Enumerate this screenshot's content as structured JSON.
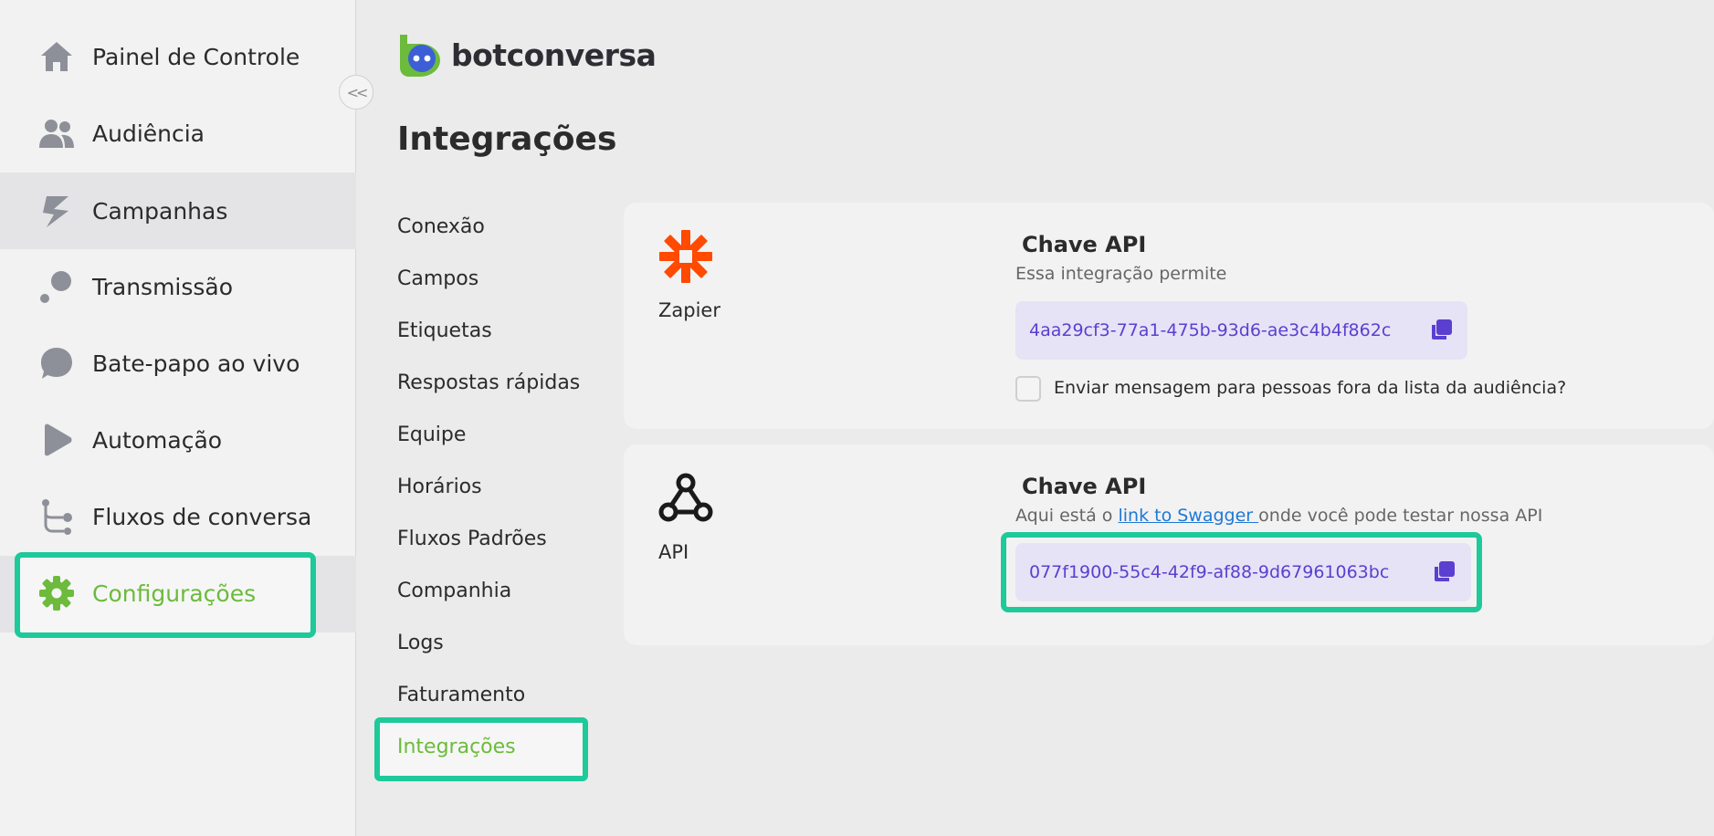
{
  "brand": {
    "name": "botconversa"
  },
  "sidebar": {
    "items": [
      {
        "label": "Painel de Controle",
        "icon": "home-icon"
      },
      {
        "label": "Audiência",
        "icon": "people-icon"
      },
      {
        "label": "Campanhas",
        "icon": "campaign-icon"
      },
      {
        "label": "Transmissão",
        "icon": "broadcast-icon"
      },
      {
        "label": "Bate-papo ao vivo",
        "icon": "chat-icon"
      },
      {
        "label": "Automação",
        "icon": "automation-icon"
      },
      {
        "label": "Fluxos de conversa",
        "icon": "flow-icon"
      },
      {
        "label": "Configurações",
        "icon": "gear-icon"
      }
    ],
    "active_item": "Configurações",
    "collapse_glyph": "<<"
  },
  "page": {
    "title": "Integrações"
  },
  "submenu": {
    "items": [
      "Conexão",
      "Campos",
      "Etiquetas",
      "Respostas rápidas",
      "Equipe",
      "Horários",
      "Fluxos Padrões",
      "Companhia",
      "Logs",
      "Faturamento",
      "Integrações"
    ],
    "active_item": "Integrações"
  },
  "integrations": {
    "zapier": {
      "name": "Zapier",
      "key_title": "Chave API",
      "description": "Essa integração permite",
      "api_key": "4aa29cf3-77a1-475b-93d6-ae3c4b4f862c",
      "checkbox_label": "Enviar mensagem para pessoas fora da lista da audiência?",
      "checkbox_checked": false
    },
    "api": {
      "name": "API",
      "key_title": "Chave API",
      "description_before": "Aqui está o ",
      "link_text": "link to Swagger ",
      "description_after": "onde você pode testar nossa API",
      "api_key": "077f1900-55c4-42f9-af88-9d67961063bc"
    }
  },
  "colors": {
    "accent_green": "#6cbb3c",
    "highlight_teal": "#1ec99a",
    "key_text_purple": "#5b3fd0",
    "key_bg": "#e6e3f6",
    "zapier_orange": "#ff4a00",
    "link_blue": "#1e78d7"
  }
}
